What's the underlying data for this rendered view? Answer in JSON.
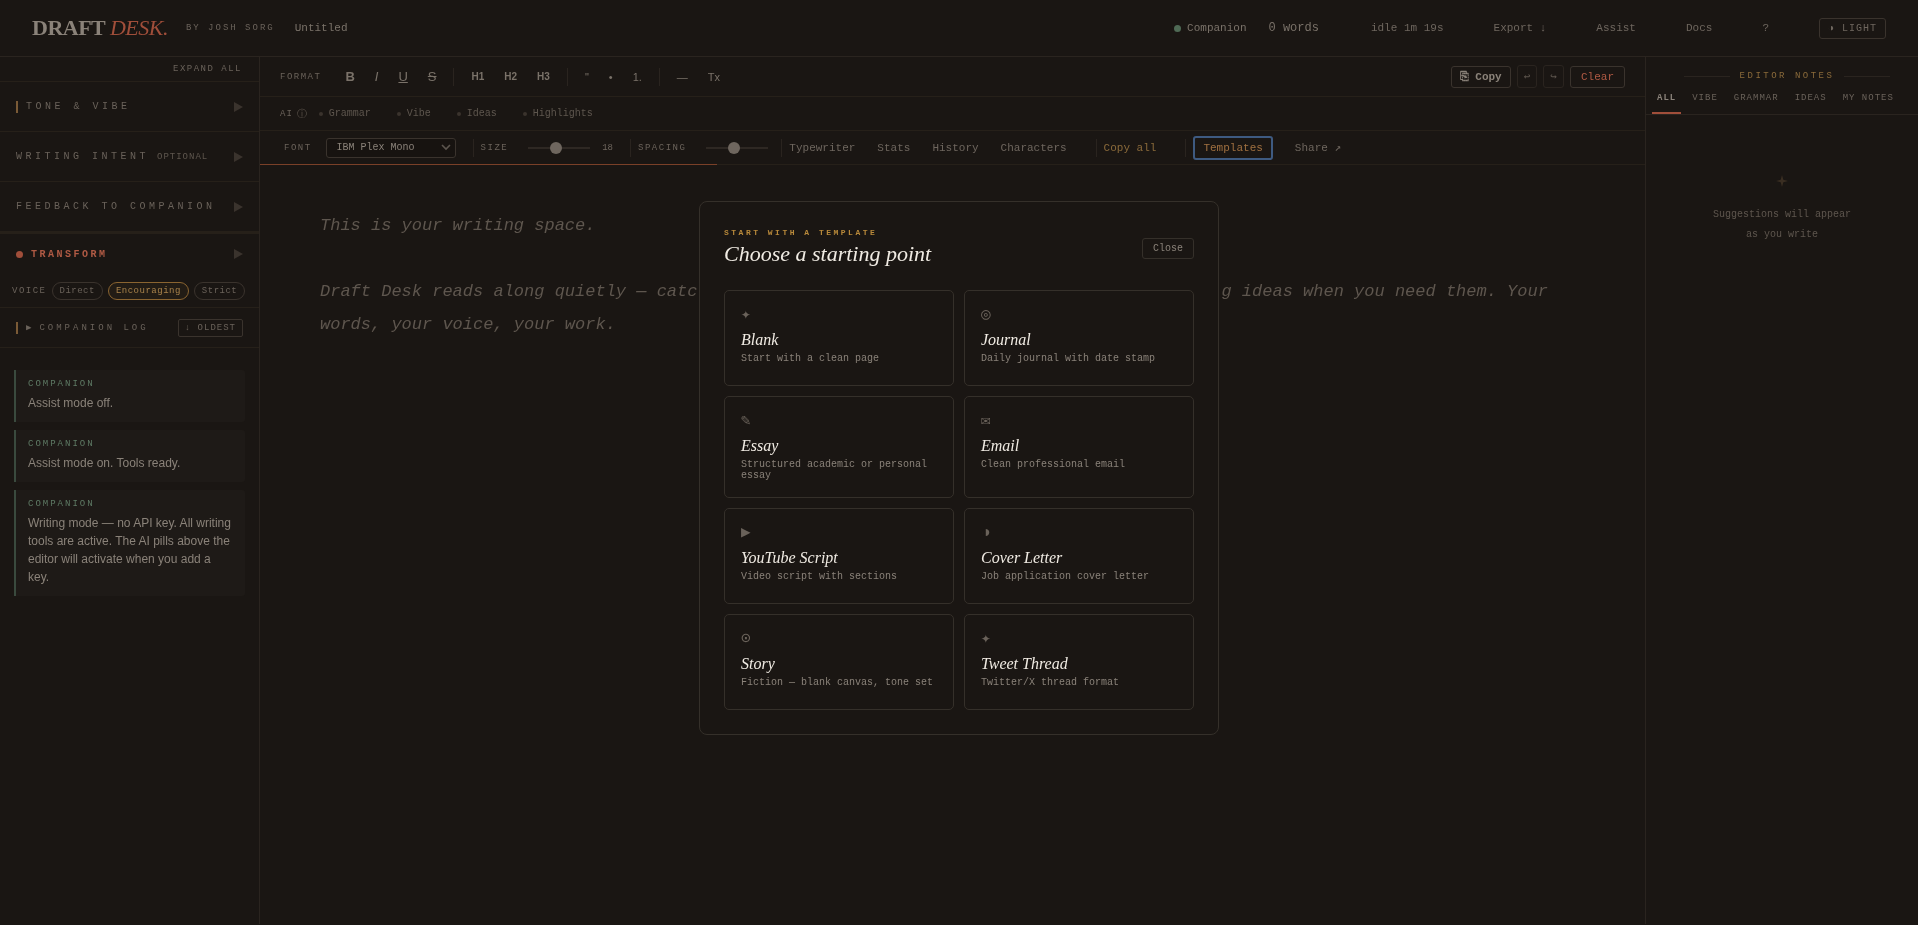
{
  "header": {
    "logo_main": "DRAFT",
    "logo_accent": "DESK.",
    "byline": "BY JOSH SORG",
    "doc_title": "Untitled",
    "companion": {
      "label": "Companion",
      "on": true
    },
    "word_count": "0 words",
    "idle": "idle 1m 19s",
    "nav": [
      "Export ↓",
      "Assist",
      "Docs",
      "?"
    ],
    "theme_button": {
      "icon": "◑",
      "label": "LIGHT"
    }
  },
  "sidebar": {
    "expand_all": "EXPAND ALL",
    "sections": [
      {
        "title": "TONE & VIBE",
        "bar_marker": true,
        "expanded": false
      },
      {
        "title": "WRITING INTENT",
        "tag": "OPTIONAL",
        "expanded": false
      },
      {
        "title": "FEEDBACK TO COMPANION",
        "expanded": false
      },
      {
        "title": "TRANSFORM",
        "dot_marker": true,
        "expanded": false
      }
    ],
    "voice": {
      "label": "VOICE",
      "options": [
        {
          "label": "Direct",
          "selected": false
        },
        {
          "label": "Encouraging",
          "selected": true
        },
        {
          "label": "Strict",
          "selected": false
        }
      ]
    },
    "log": {
      "toggle": "▶",
      "title": "COMPANION LOG",
      "sort_button": "↓ OLDEST",
      "entries": [
        {
          "author": "COMPANION",
          "text": "Assist mode off."
        },
        {
          "author": "COMPANION",
          "text": "Assist mode on. Tools ready."
        },
        {
          "author": "COMPANION",
          "text": "Writing mode — no API key. All writing tools are active. The AI pills above the editor will activate when you add a key."
        }
      ]
    }
  },
  "toolbar": {
    "format_label": "FORMAT",
    "groups": [
      [
        {
          "label": "B",
          "kind": "bold"
        },
        {
          "label": "I",
          "kind": "italic"
        },
        {
          "label": "U",
          "kind": "underline"
        },
        {
          "label": "S",
          "kind": "strike"
        }
      ],
      [
        {
          "label": "H1",
          "kind": "heading"
        },
        {
          "label": "H2",
          "kind": "heading"
        },
        {
          "label": "H3",
          "kind": "heading"
        }
      ],
      [
        {
          "label": "\"",
          "kind": "plain"
        },
        {
          "label": "•",
          "kind": "plain"
        },
        {
          "label": "1.",
          "kind": "plain"
        }
      ],
      [
        {
          "label": "—",
          "kind": "plain"
        },
        {
          "label": "Tx",
          "kind": "plain"
        }
      ]
    ],
    "copy": {
      "icon": "⎘",
      "label": "Copy"
    },
    "undo": {
      "label": "↩",
      "disabled": true
    },
    "redo": {
      "label": "↪",
      "disabled": true
    },
    "clear": "Clear"
  },
  "ai_row": {
    "label": "AI",
    "info": "ⓘ",
    "pills": [
      {
        "label": "Grammar"
      },
      {
        "label": "Vibe"
      },
      {
        "label": "Ideas"
      },
      {
        "label": "Highlights"
      }
    ]
  },
  "font_row": {
    "font_label": "FONT",
    "font": "IBM Plex Mono",
    "size_label": "SIZE",
    "size": {
      "level": 0.45,
      "value": "18"
    },
    "spacing_label": "SPACING",
    "spacing": {
      "level": 0.45
    },
    "tools": [
      {
        "label": "Typewriter",
        "kind": "plain",
        "selected": false
      },
      {
        "label": "Stats",
        "kind": "plain",
        "selected": false
      },
      {
        "label": "History",
        "kind": "plain",
        "selected": false
      },
      {
        "label": "Characters",
        "kind": "plain",
        "selected": false
      },
      {
        "label": "Copy all",
        "kind": "accent",
        "selected": false
      },
      {
        "label": "Templates",
        "kind": "accent",
        "selected": true
      },
      {
        "label": "Share ↗",
        "kind": "plain",
        "selected": false
      }
    ],
    "progress": {
      "level": 0.33
    }
  },
  "editor": {
    "first_line": "This is your writing space.",
    "para_left": "Draft Desk reads along quietly — catc",
    "para_right": "g ideas when you need them. Your",
    "para_end": "words, your voice, your work."
  },
  "notes": {
    "title": "EDITOR NOTES",
    "tabs": [
      {
        "label": "ALL",
        "selected": true
      },
      {
        "label": "VIBE",
        "selected": false
      },
      {
        "label": "GRAMMAR",
        "selected": false
      },
      {
        "label": "IDEAS",
        "selected": false
      },
      {
        "label": "MY NOTES",
        "selected": false
      }
    ],
    "empty": "Suggestions will appear as you write"
  },
  "modal": {
    "eyebrow": "START WITH A TEMPLATE",
    "title": "Choose a starting point",
    "close": "Close",
    "templates": [
      {
        "icon": "✦",
        "name": "Blank",
        "desc": "Start with a clean page"
      },
      {
        "icon": "◎",
        "name": "Journal",
        "desc": "Daily journal with date stamp"
      },
      {
        "icon": "✎",
        "name": "Essay",
        "desc": "Structured academic or personal essay"
      },
      {
        "icon": "✉",
        "name": "Email",
        "desc": "Clean professional email"
      },
      {
        "icon": "▶",
        "name": "YouTube Script",
        "desc": "Video script with sections"
      },
      {
        "icon": "◑",
        "name": "Cover Letter",
        "desc": "Job application cover letter"
      },
      {
        "icon": "⊙",
        "name": "Story",
        "desc": "Fiction — blank canvas, tone set"
      },
      {
        "icon": "✦",
        "name": "Tweet Thread",
        "desc": "Twitter/X thread format"
      }
    ]
  }
}
